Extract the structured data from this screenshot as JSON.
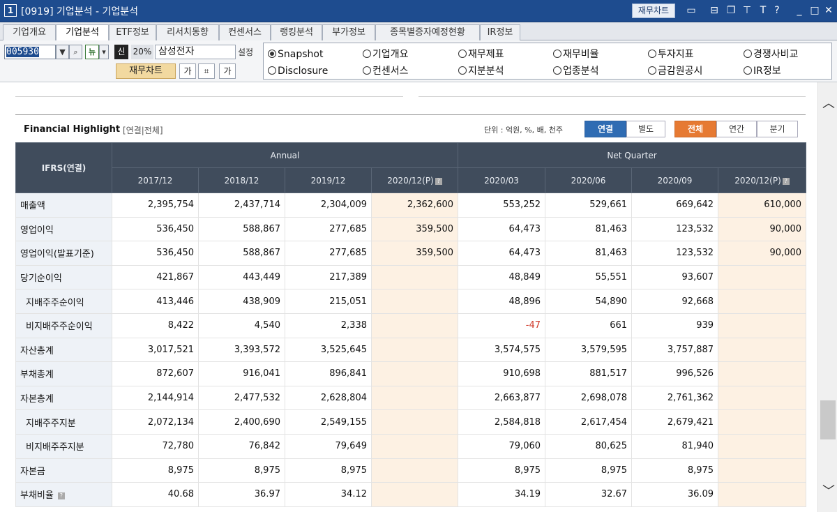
{
  "window": {
    "number": "1",
    "title": "[0919] 기업분석 - 기업분석",
    "chart_button": "재무차트",
    "icons": [
      "monitor-icon",
      "layout-icon",
      "copy-icon",
      "pin-icon",
      "font-icon",
      "help-icon",
      "minimize-icon",
      "maximize-icon",
      "close-icon"
    ]
  },
  "tabs": [
    {
      "label": "기업개요",
      "active": false
    },
    {
      "label": "기업분석",
      "active": true
    },
    {
      "label": "ETF정보",
      "active": false
    },
    {
      "label": "리서치동향",
      "active": false
    },
    {
      "label": "컨센서스",
      "active": false
    },
    {
      "label": "랭킹분석",
      "active": false
    },
    {
      "label": "부가정보",
      "active": false
    },
    {
      "label": "종목별증자예정현황",
      "active": false
    },
    {
      "label": "IR정보",
      "active": false
    }
  ],
  "controls": {
    "code": "005930",
    "new_label": "뉴",
    "sin_label": "신",
    "percent": "20%",
    "company": "삼성전자",
    "setting": "설정",
    "fin_chart_button": "재무차트",
    "font_up": "가",
    "font_down": "가"
  },
  "radios": [
    {
      "label": "Snapshot",
      "selected": true
    },
    {
      "label": "기업개요",
      "selected": false
    },
    {
      "label": "재무제표",
      "selected": false
    },
    {
      "label": "재무비율",
      "selected": false
    },
    {
      "label": "투자지표",
      "selected": false
    },
    {
      "label": "경쟁사비교",
      "selected": false
    },
    {
      "label": "Disclosure",
      "selected": false
    },
    {
      "label": "컨센서스",
      "selected": false
    },
    {
      "label": "지분분석",
      "selected": false
    },
    {
      "label": "업종분석",
      "selected": false
    },
    {
      "label": "금감원공시",
      "selected": false
    },
    {
      "label": "IR정보",
      "selected": false
    }
  ],
  "highlight": {
    "title": "Financial Highlight",
    "subtitle": "[연결|전체]",
    "unit": "단위 : 억원, %, 배, 천주",
    "basis_buttons": [
      "연결",
      "별도"
    ],
    "period_buttons": [
      "전체",
      "연간",
      "분기"
    ]
  },
  "table": {
    "corner": "IFRS(연결)",
    "group_annual": "Annual",
    "group_quarter": "Net Quarter",
    "columns": [
      "2017/12",
      "2018/12",
      "2019/12",
      "2020/12(P)",
      "2020/03",
      "2020/06",
      "2020/09",
      "2020/12(P)"
    ],
    "rows": [
      {
        "label": "매출액",
        "sub": false,
        "values": [
          "2,395,754",
          "2,437,714",
          "2,304,009",
          "2,362,600",
          "553,252",
          "529,661",
          "669,642",
          "610,000"
        ]
      },
      {
        "label": "영업이익",
        "sub": false,
        "values": [
          "536,450",
          "588,867",
          "277,685",
          "359,500",
          "64,473",
          "81,463",
          "123,532",
          "90,000"
        ]
      },
      {
        "label": "영업이익(발표기준)",
        "sub": false,
        "values": [
          "536,450",
          "588,867",
          "277,685",
          "359,500",
          "64,473",
          "81,463",
          "123,532",
          "90,000"
        ]
      },
      {
        "label": "당기순이익",
        "sub": false,
        "values": [
          "421,867",
          "443,449",
          "217,389",
          "",
          "48,849",
          "55,551",
          "93,607",
          ""
        ]
      },
      {
        "label": "지배주주순이익",
        "sub": true,
        "values": [
          "413,446",
          "438,909",
          "215,051",
          "",
          "48,896",
          "54,890",
          "92,668",
          ""
        ]
      },
      {
        "label": "비지배주주순이익",
        "sub": true,
        "values": [
          "8,422",
          "4,540",
          "2,338",
          "",
          "-47",
          "661",
          "939",
          ""
        ]
      },
      {
        "label": "자산총계",
        "sub": false,
        "values": [
          "3,017,521",
          "3,393,572",
          "3,525,645",
          "",
          "3,574,575",
          "3,579,595",
          "3,757,887",
          ""
        ]
      },
      {
        "label": "부채총계",
        "sub": false,
        "values": [
          "872,607",
          "916,041",
          "896,841",
          "",
          "910,698",
          "881,517",
          "996,526",
          ""
        ]
      },
      {
        "label": "자본총계",
        "sub": false,
        "values": [
          "2,144,914",
          "2,477,532",
          "2,628,804",
          "",
          "2,663,877",
          "2,698,078",
          "2,761,362",
          ""
        ]
      },
      {
        "label": "지배주주지분",
        "sub": true,
        "values": [
          "2,072,134",
          "2,400,690",
          "2,549,155",
          "",
          "2,584,818",
          "2,617,454",
          "2,679,421",
          ""
        ]
      },
      {
        "label": "비지배주주지분",
        "sub": true,
        "values": [
          "72,780",
          "76,842",
          "79,649",
          "",
          "79,060",
          "80,625",
          "81,940",
          ""
        ]
      },
      {
        "label": "자본금",
        "sub": false,
        "values": [
          "8,975",
          "8,975",
          "8,975",
          "",
          "8,975",
          "8,975",
          "8,975",
          ""
        ]
      },
      {
        "label": "부채비율",
        "sub": false,
        "values": [
          "40.68",
          "36.97",
          "34.12",
          "",
          "34.19",
          "32.67",
          "36.09",
          ""
        ]
      }
    ]
  }
}
